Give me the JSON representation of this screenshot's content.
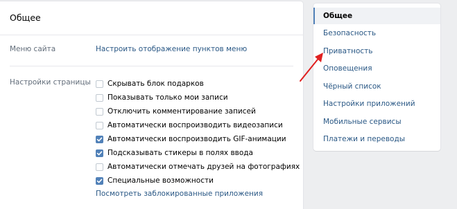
{
  "main": {
    "title": "Общее",
    "menu_row": {
      "label": "Меню сайта",
      "link": "Настроить отображение пунктов меню"
    },
    "page_settings": {
      "label": "Настройки страницы",
      "options": [
        {
          "label": "Скрывать блок подарков",
          "checked": false
        },
        {
          "label": "Показывать только мои записи",
          "checked": false
        },
        {
          "label": "Отключить комментирование записей",
          "checked": false
        },
        {
          "label": "Автоматически воспроизводить видеозаписи",
          "checked": false
        },
        {
          "label": "Автоматически воспроизводить GIF-анимации",
          "checked": true
        },
        {
          "label": "Подсказывать стикеры в полях ввода",
          "checked": true
        },
        {
          "label": "Автоматически отмечать друзей на фотографиях",
          "checked": false
        },
        {
          "label": "Специальные возможности",
          "checked": true
        }
      ],
      "blocked_apps_link": "Посмотреть заблокированные приложения"
    }
  },
  "nav": {
    "items": [
      {
        "label": "Общее",
        "active": true
      },
      {
        "label": "Безопасность",
        "active": false
      },
      {
        "label": "Приватность",
        "active": false
      },
      {
        "label": "Оповещения",
        "active": false
      },
      {
        "label": "Чёрный список",
        "active": false
      },
      {
        "label": "Настройки приложений",
        "active": false
      },
      {
        "label": "Мобильные сервисы",
        "active": false
      },
      {
        "label": "Платежи и переводы",
        "active": false
      }
    ]
  },
  "colors": {
    "accent": "#5181b8",
    "link": "#2a5885",
    "annotation_arrow": "#e02020"
  }
}
